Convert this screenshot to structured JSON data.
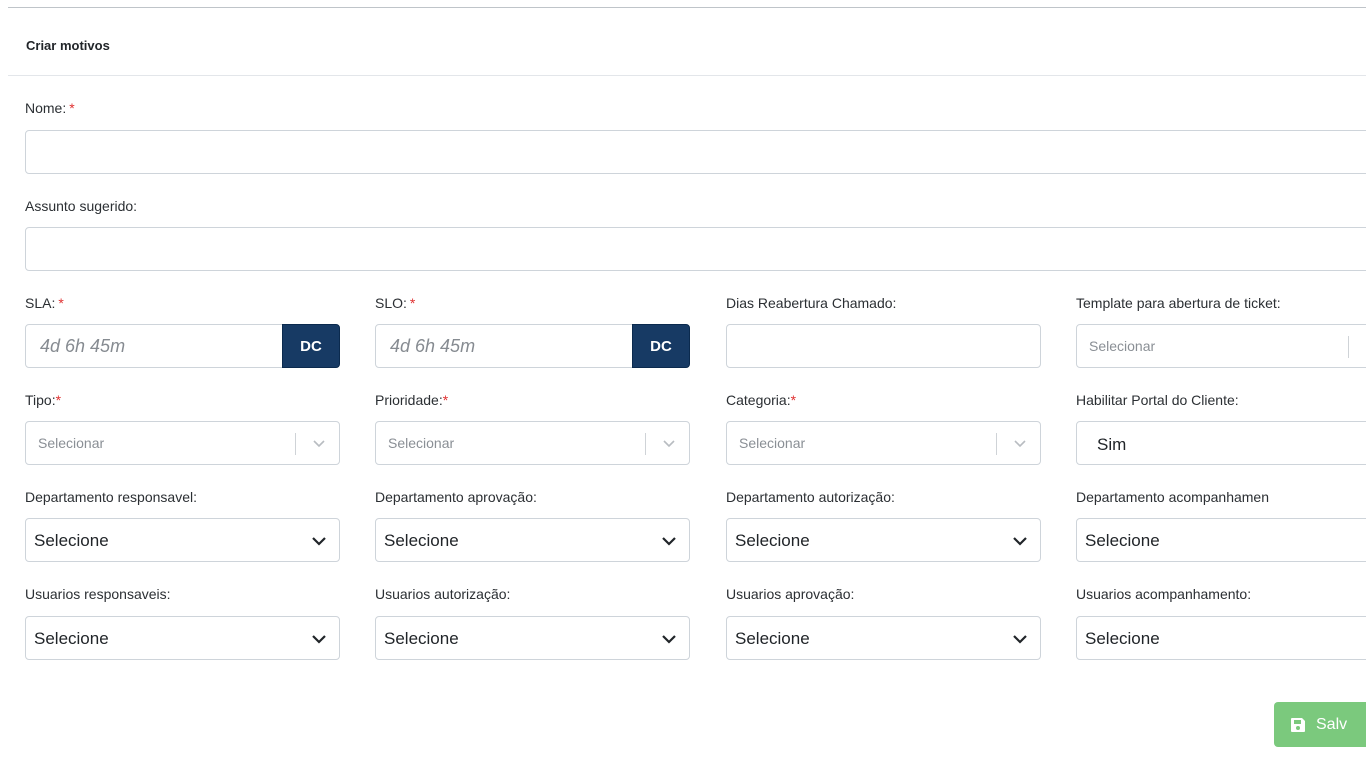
{
  "header": {
    "title": "Criar motivos"
  },
  "fields": {
    "nome": {
      "label": "Nome:",
      "required": "*",
      "value": ""
    },
    "assunto": {
      "label": "Assunto sugerido:",
      "value": ""
    },
    "sla": {
      "label": "SLA:",
      "required": "*",
      "placeholder": "4d 6h 45m",
      "button": "DC"
    },
    "slo": {
      "label": "SLO:",
      "required": "*",
      "placeholder": "4d 6h 45m",
      "button": "DC"
    },
    "dias": {
      "label": "Dias Reabertura Chamado:",
      "value": ""
    },
    "template": {
      "label": "Template para abertura de ticket:",
      "placeholder": "Selecionar"
    },
    "tipo": {
      "label": "Tipo:",
      "required": "*",
      "placeholder": "Selecionar"
    },
    "prioridade": {
      "label": "Prioridade:",
      "required": "*",
      "placeholder": "Selecionar"
    },
    "categoria": {
      "label": "Categoria:",
      "required": "*",
      "placeholder": "Selecionar"
    },
    "portal": {
      "label": "Habilitar Portal do Cliente:",
      "value": "Sim"
    },
    "dep_resp": {
      "label": "Departamento responsavel:",
      "value": "Selecione"
    },
    "dep_aprov": {
      "label": "Departamento aprovação:",
      "value": "Selecione"
    },
    "dep_autor": {
      "label": "Departamento autorização:",
      "value": "Selecione"
    },
    "dep_acomp": {
      "label": "Departamento acompanhamen",
      "value": "Selecione"
    },
    "usr_resp": {
      "label": "Usuarios responsaveis:",
      "value": "Selecione"
    },
    "usr_autor": {
      "label": "Usuarios autorização:",
      "value": "Selecione"
    },
    "usr_aprov": {
      "label": "Usuarios aprovação:",
      "value": "Selecione"
    },
    "usr_acomp": {
      "label": "Usuarios acompanhamento:",
      "value": "Selecione"
    }
  },
  "actions": {
    "save_label": "Salv"
  },
  "colors": {
    "primary_dark": "#173a64",
    "required": "#e03131",
    "save": "#7bc97d"
  }
}
